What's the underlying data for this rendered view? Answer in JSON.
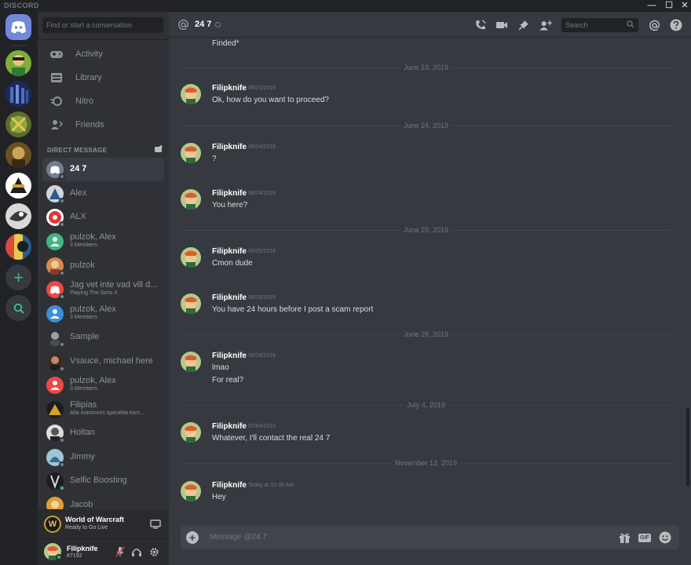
{
  "app": {
    "title": "DISCORD"
  },
  "window": {
    "minimize": "—",
    "maximize": "☐",
    "close": "✕"
  },
  "sidebar": {
    "search_placeholder": "Find or start a conversation",
    "nav": [
      {
        "label": "Activity",
        "icon": "activity-icon"
      },
      {
        "label": "Library",
        "icon": "library-icon"
      },
      {
        "label": "Nitro",
        "icon": "nitro-icon"
      },
      {
        "label": "Friends",
        "icon": "friends-icon"
      }
    ],
    "dm_header": "DIRECT MESSAGE",
    "dms": [
      {
        "name": "24 7",
        "sub": ""
      },
      {
        "name": "Alex",
        "sub": ""
      },
      {
        "name": "ALX",
        "sub": ""
      },
      {
        "name": "pulzok, Alex",
        "sub": "3 Members"
      },
      {
        "name": "pulzok",
        "sub": ""
      },
      {
        "name": "Jag vet inte vad vill d...",
        "sub": "Playing The Sims 4"
      },
      {
        "name": "pulzok, Alex",
        "sub": "3 Members"
      },
      {
        "name": "Sample",
        "sub": ""
      },
      {
        "name": "Vsauce, michael here",
        "sub": ""
      },
      {
        "name": "pulzok, Alex",
        "sub": "3 Members"
      },
      {
        "name": "Filipias",
        "sub": "Alla mammors speciella kom..."
      },
      {
        "name": "Holtan",
        "sub": ""
      },
      {
        "name": "Jimmy",
        "sub": ""
      },
      {
        "name": "Selfic Boosting",
        "sub": ""
      },
      {
        "name": "Jacob",
        "sub": ""
      }
    ],
    "activity": {
      "game": "World of Warcraft",
      "status": "Ready to Go Live"
    },
    "user": {
      "name": "Filipknife",
      "tag": "#7192"
    }
  },
  "header": {
    "channel": "24 7",
    "search_placeholder": "Search",
    "icons": [
      "call-icon",
      "video-icon",
      "pin-icon",
      "add-friend-icon",
      "mention-icon",
      "help-icon"
    ]
  },
  "messages": {
    "stray_text": "Finded*",
    "dividers": [
      "June 23, 2019",
      "June 24, 2019",
      "June 25, 2019",
      "June 28, 2019",
      "July 4, 2019",
      "November 12, 2019"
    ],
    "items": [
      {
        "author": "Filipknife",
        "timestamp": "06/23/2019",
        "lines": [
          "Ok, how do you want to proceed?"
        ]
      },
      {
        "author": "Filipknife",
        "timestamp": "06/24/2019",
        "lines": [
          "?"
        ]
      },
      {
        "author": "Filipknife",
        "timestamp": "06/24/2019",
        "lines": [
          "You here?"
        ]
      },
      {
        "author": "Filipknife",
        "timestamp": "06/25/2019",
        "lines": [
          "Cmon dude"
        ]
      },
      {
        "author": "Filipknife",
        "timestamp": "06/25/2019",
        "lines": [
          "You have 24 hours before I post a scam report"
        ]
      },
      {
        "author": "Filipknife",
        "timestamp": "06/28/2019",
        "lines": [
          "lmao",
          "For real?"
        ]
      },
      {
        "author": "Filipknife",
        "timestamp": "07/04/2019",
        "lines": [
          "Whatever, I'll contact the real 24 7"
        ]
      },
      {
        "author": "Filipknife",
        "timestamp": "Today at 10:35 AM",
        "lines": [
          "Hey"
        ]
      }
    ]
  },
  "composer": {
    "placeholder": "Message @24 7",
    "gif_label": "GIF"
  },
  "colors": {
    "accent": "#7289da",
    "online": "#43b581",
    "bg_main": "#36393f",
    "bg_sidebar": "#2f3136",
    "bg_rail": "#202225"
  }
}
